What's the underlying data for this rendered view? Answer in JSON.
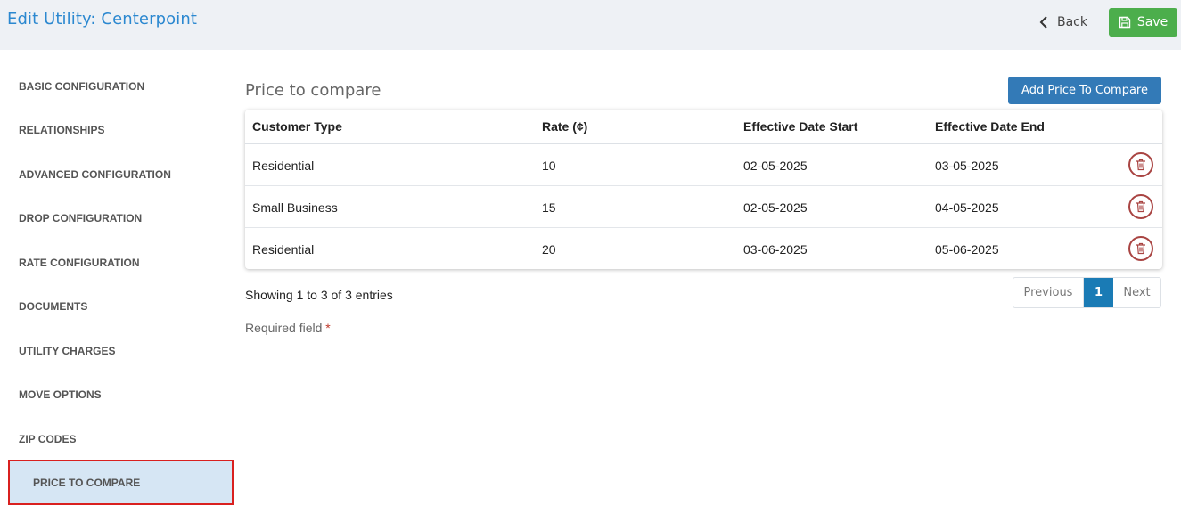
{
  "header": {
    "title": "Edit Utility: Centerpoint",
    "back_label": "Back",
    "save_label": "Save"
  },
  "sidebar": {
    "items": [
      {
        "label": "BASIC CONFIGURATION"
      },
      {
        "label": "RELATIONSHIPS"
      },
      {
        "label": "ADVANCED CONFIGURATION"
      },
      {
        "label": "DROP CONFIGURATION"
      },
      {
        "label": "RATE CONFIGURATION"
      },
      {
        "label": "DOCUMENTS"
      },
      {
        "label": "UTILITY CHARGES"
      },
      {
        "label": "MOVE OPTIONS"
      },
      {
        "label": "ZIP CODES"
      },
      {
        "label": "PRICE TO COMPARE",
        "active": true
      }
    ]
  },
  "main": {
    "section_title": "Price to compare",
    "add_button_label": "Add Price To Compare",
    "table": {
      "columns": [
        "Customer Type",
        "Rate (¢)",
        "Effective Date Start",
        "Effective Date End"
      ],
      "rows": [
        [
          "Residential",
          "10",
          "02-05-2025",
          "03-05-2025"
        ],
        [
          "Small Business",
          "15",
          "02-05-2025",
          "04-05-2025"
        ],
        [
          "Residential",
          "20",
          "03-06-2025",
          "05-06-2025"
        ]
      ]
    },
    "entries_text": "Showing 1 to 3 of 3 entries",
    "pagination": {
      "previous": "Previous",
      "current": "1",
      "next": "Next"
    },
    "required_text": "Required field",
    "required_mark": "*"
  },
  "colors": {
    "title": "#2b88d0",
    "save": "#4cae4c",
    "add_button": "#337ab7",
    "active_page": "#1a7bb5",
    "delete": "#a94442",
    "active_highlight_border": "#d9201f"
  },
  "icons": {
    "back": "chevron-left-icon",
    "save": "floppy-disk-icon",
    "delete": "trash-icon"
  }
}
